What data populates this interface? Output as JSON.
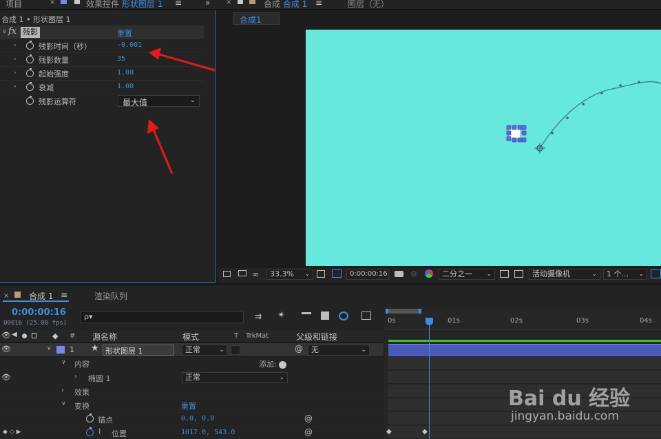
{
  "top_tabs": {
    "project": "项目",
    "effect_controls_prefix": "效果控件",
    "effect_controls_layer": "形状图层 1",
    "comp_prefix": "合成",
    "comp_name": "合成 1",
    "layer_tab": "图层（无）"
  },
  "effect_panel": {
    "breadcrumb": "合成 1 • 形状图层 1",
    "fx": "fx",
    "effect_name": "残影",
    "reset": "重置",
    "props": [
      {
        "label": "残影时间（秒）",
        "value": "-0.001"
      },
      {
        "label": "残影数量",
        "value": "35"
      },
      {
        "label": "起始强度",
        "value": "1.00"
      },
      {
        "label": "衰减",
        "value": "1.00"
      },
      {
        "label": "残影运算符",
        "value": "最大值"
      }
    ]
  },
  "viewer": {
    "comp_tab": "合成1",
    "zoom": "33.3%",
    "timecode": "0:00:00:16",
    "resolution": "二分之一",
    "camera": "活动摄像机",
    "views": "1 个...",
    "canvas_color": "#66e8dc"
  },
  "timeline": {
    "tab_comp": "合成 1",
    "tab_render": "渲染队列",
    "timecode": "0:00:00:16",
    "frames": "00016 (25.00 fps)",
    "search_placeholder": "ρ▾",
    "col_num": "#",
    "col_source": "源名称",
    "col_mode": "模式",
    "col_t": "T",
    "col_trkmat": "TrkMat",
    "col_parent": "父级和链接",
    "ruler": [
      "0s",
      "01s",
      "02s",
      "03s",
      "04s"
    ],
    "layer": {
      "num": "1",
      "name": "形状图层 1",
      "mode": "正常",
      "parent": "无"
    },
    "contents": "内容",
    "add": "添加:",
    "ellipse": "椭圆 1",
    "ellipse_mode": "正常",
    "effects": "效果",
    "transform": "变换",
    "transform_reset": "重置",
    "anchor": "锚点",
    "anchor_value": "0.0, 0.0",
    "position": "位置",
    "position_value": "1017.0, 543.0"
  },
  "watermark": {
    "brand": "Bai du 经验",
    "url": "jingyan.baidu.com"
  }
}
